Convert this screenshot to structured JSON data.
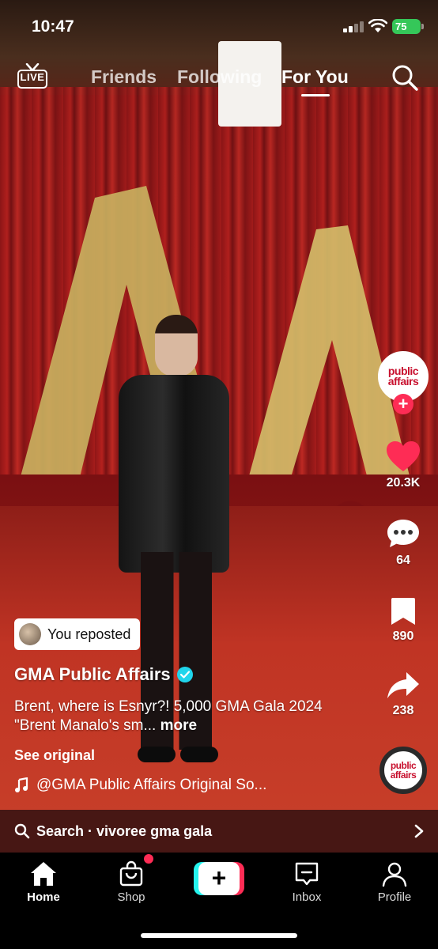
{
  "status_bar": {
    "time": "10:47",
    "battery": "75"
  },
  "top_nav": {
    "live_label": "LIVE",
    "tabs": [
      {
        "label": "Friends"
      },
      {
        "label": "Following"
      },
      {
        "label": "For You"
      }
    ],
    "active_tab": "For You"
  },
  "video": {
    "account_avatar_text": "public affairs",
    "likes": "20.3K",
    "comments": "64",
    "bookmarks": "890",
    "shares": "238",
    "reposted_label": "You reposted",
    "author": "GMA Public Affairs",
    "caption": "Brent, where is Esnyr?! 5,000 GMA Gala 2024 \"Brent Manalo's sm...",
    "more_label": "more",
    "see_original": "See original",
    "sound": "@GMA Public Affairs Original So..."
  },
  "search_bar": {
    "text": "Search · vivoree gma gala"
  },
  "bottom_nav": {
    "items": [
      {
        "label": "Home"
      },
      {
        "label": "Shop"
      },
      {
        "label": "Profile"
      },
      {
        "label": "Inbox"
      }
    ],
    "create_symbol": "+"
  },
  "colors": {
    "accent": "#fe2c55",
    "accent_cyan": "#25f4ee",
    "battery": "#35c759",
    "verified": "#20d5ec"
  }
}
